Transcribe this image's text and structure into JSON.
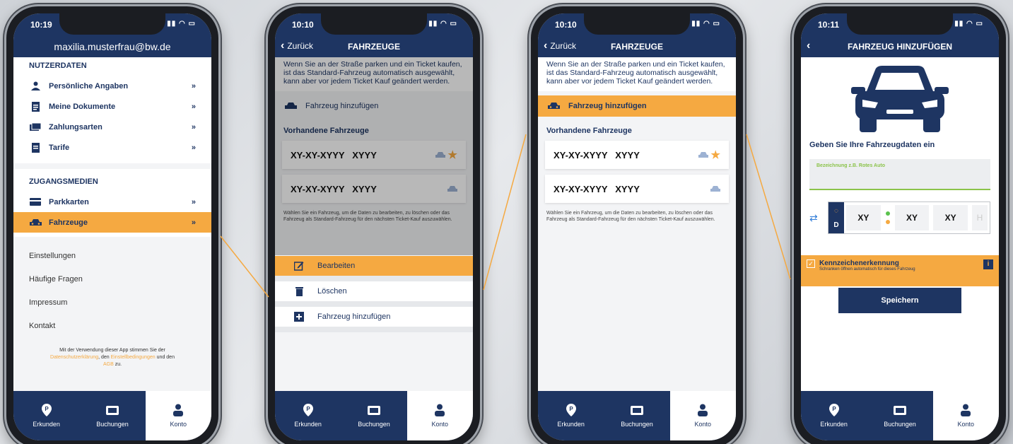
{
  "statusbars": [
    "10:19",
    "10:10",
    "10:10",
    "10:11"
  ],
  "tabs": [
    {
      "label": "Erkunden",
      "icon": "map-pin-icon"
    },
    {
      "label": "Buchungen",
      "icon": "ticket-icon"
    },
    {
      "label": "Konto",
      "icon": "person-icon"
    }
  ],
  "screen1": {
    "email": "maxilia.musterfrau@bw.de",
    "section1_title": "NUTZERDATEN",
    "section1_items": [
      "Persönliche Angaben",
      "Meine Dokumente",
      "Zahlungsarten",
      "Tarife"
    ],
    "section2_title": "ZUGANGSMEDIEN",
    "section2_items": [
      "Parkkarten",
      "Fahrzeuge"
    ],
    "chevron": "»",
    "plain_items": [
      "Einstellungen",
      "Häufige Fragen",
      "Impressum",
      "Kontakt"
    ],
    "legal_1": "Mit der Verwendung dieser App stimmen Sie der",
    "legal_link1": "Datenschutzerklärung",
    "legal_2": ", den",
    "legal_link2": "Einstellbedingungen",
    "legal_3": "und den",
    "legal_link3": "AGB",
    "legal_4": "zu."
  },
  "vehicles": {
    "back": "Zurück",
    "title": "FAHRZEUGE",
    "info": "Wenn Sie an der Straße parken und ein Ticket kaufen, ist das Standard-Fahrzeug automatisch ausgewählt, kann aber vor jedem Ticket Kauf geändert werden.",
    "add": "Fahrzeug hinzufügen",
    "list_title": "Vorhandene Fahrzeuge",
    "plates": [
      "XY-XY-XYYY   XYYY",
      "XY-XY-XYYY   XYYY"
    ],
    "hint": "Wählen Sie ein Fahrzeug, um die Daten zu bearbeiten, zu löschen oder das Fahrzeug als Standard-Fahrzeug für den nächsten Ticket-Kauf auszuwählen."
  },
  "sheet": {
    "edit": "Bearbeiten",
    "delete": "Löschen",
    "add": "Fahrzeug hinzufügen"
  },
  "screen4": {
    "title": "FAHRZEUG HINZUFÜGEN",
    "form_head": "Geben Sie Ihre Fahrzeugdaten ein",
    "placeholder": "Bezeichnung z.B. Rotes Auto",
    "country": "D",
    "plate_parts": [
      "XY",
      "XY",
      "XY",
      "H"
    ],
    "knz_title": "Kennzeichenerkennung",
    "knz_sub": "Schranken öffnen automatisch für dieses Fahrzeug",
    "save": "Speichern"
  },
  "colors": {
    "navy": "#1e3562",
    "orange": "#f5a941"
  }
}
